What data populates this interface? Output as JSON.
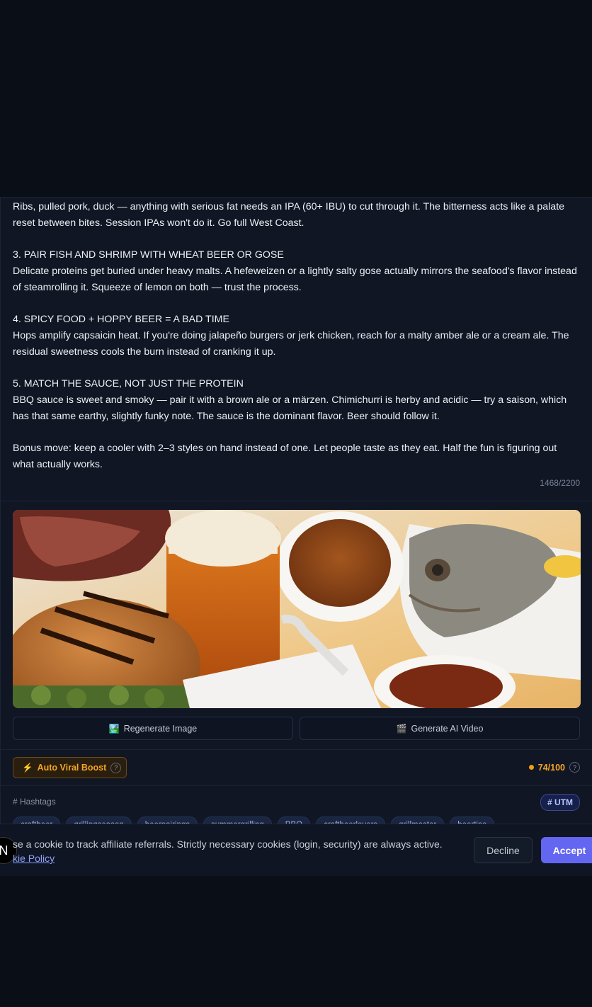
{
  "post": {
    "p1": "Ribs, pulled pork, duck — anything with serious fat needs an IPA (60+ IBU) to cut through it. The bitterness acts like a palate reset between bites. Session IPAs won't do it. Go full West Coast.",
    "h3": "3. PAIR FISH AND SHRIMP WITH WHEAT BEER OR GOSE",
    "p3": "Delicate proteins get buried under heavy malts. A hefeweizen or a lightly salty gose actually mirrors the seafood's flavor instead of steamrolling it. Squeeze of lemon on both — trust the process.",
    "h4": "4. SPICY FOOD + HOPPY BEER = A BAD TIME",
    "p4": "Hops amplify capsaicin heat. If you're doing jalapeño burgers or jerk chicken, reach for a malty amber ale or a cream ale. The residual sweetness cools the burn instead of cranking it up.",
    "h5": "5. MATCH THE SAUCE, NOT JUST THE PROTEIN",
    "p5": "BBQ sauce is sweet and smoky — pair it with a brown ale or a märzen. Chimichurri is herby and acidic — try a saison, which has that same earthy, slightly funky note. The sauce is the dominant flavor. Beer should follow it.",
    "bonus": "Bonus move: keep a cooler with 2–3 styles on hand instead of one. Let people taste as they eat. Half the fun is figuring out what actually works.",
    "char_count": "1468/2200"
  },
  "actions": {
    "regenerate_image": "Regenerate Image",
    "regenerate_icon": "🏞️",
    "generate_video": "Generate AI Video",
    "generate_video_icon": "🎬"
  },
  "boost": {
    "label": "Auto Viral Boost",
    "icon": "⚡",
    "help": "?",
    "score": "74/100",
    "score_help": "?"
  },
  "hashtags": {
    "label": "# Hashtags",
    "utm": "# UTM",
    "items": [
      "craftbeer",
      "grillingseason",
      "beerpairings",
      "summergrilling",
      "BBQ",
      "craftbeerlovers",
      "grillmaster",
      "beertips"
    ]
  },
  "cookie": {
    "text": "se a cookie to track affiliate referrals. Strictly necessary cookies (login, security) are always active.",
    "link": "kie Policy",
    "decline": "Decline",
    "accept": "Accept",
    "badge": "N"
  },
  "colors": {
    "accent": "#6366f1",
    "boost": "#f5a524",
    "background": "#0a0e17"
  }
}
